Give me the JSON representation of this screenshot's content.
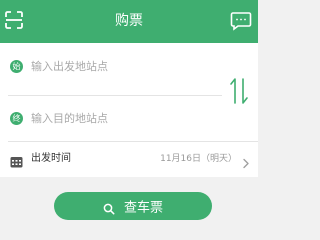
{
  "header": {
    "title": "购票"
  },
  "icons": {
    "scan": "scan-icon",
    "message": "message-icon",
    "swap": "swap-icon",
    "calendar": "calendar-icon",
    "chevron": "chevron-right-icon",
    "search": "search-icon"
  },
  "form": {
    "from": {
      "badge": "始",
      "placeholder": "输入出发地站点"
    },
    "to": {
      "badge": "终",
      "placeholder": "输入目的地站点"
    },
    "date": {
      "label": "出发时间",
      "value": "11月16日（明天）"
    }
  },
  "action": {
    "search_label": "查车票"
  },
  "colors": {
    "brand": "#3fae70",
    "background": "#f1f1f1",
    "placeholder": "#a9a9a9"
  }
}
